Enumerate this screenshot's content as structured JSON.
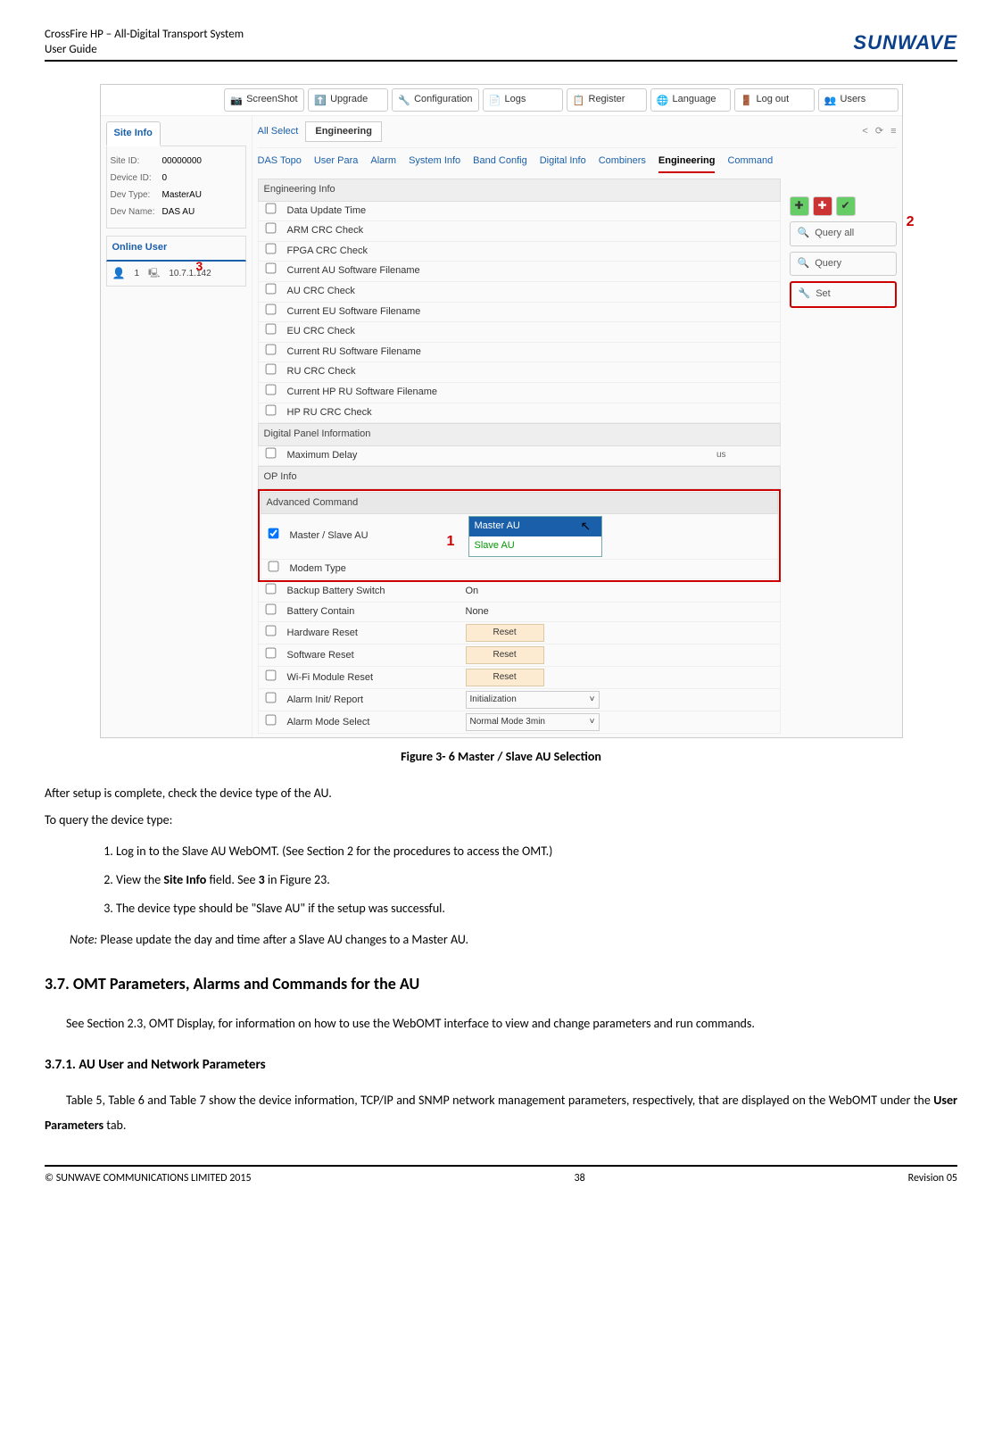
{
  "header": {
    "title": "CrossFire HP – All-Digital Transport System",
    "subtitle": "User Guide",
    "logo": "SUNWAVE"
  },
  "toolbar": {
    "screenshot": "ScreenShot",
    "upgrade": "Upgrade",
    "configuration": "Configuration",
    "logs": "Logs",
    "register": "Register",
    "language": "Language",
    "logout": "Log out",
    "users": "Users"
  },
  "siteinfo": {
    "tab": "Site Info",
    "site_id_lbl": "Site ID:",
    "site_id": "00000000",
    "device_id_lbl": "Device ID:",
    "device_id": "0",
    "dev_type_lbl": "Dev Type:",
    "dev_type": "MasterAU",
    "dev_name_lbl": "Dev Name:",
    "dev_name": "DAS AU",
    "online_user": "Online User",
    "user_num": "1",
    "ip": "10.7.1.142"
  },
  "anno": {
    "a1": "1",
    "a2": "2",
    "a3": "3"
  },
  "toptabs": {
    "all_select": "All Select",
    "engineering": "Engineering"
  },
  "navtabs": [
    "DAS Topo",
    "User Para",
    "Alarm",
    "System Info",
    "Band Config",
    "Digital Info",
    "Combiners",
    "Engineering",
    "Command"
  ],
  "sections": {
    "eng_info": "Engineering Info",
    "digital_panel": "Digital Panel Information",
    "op_info": "OP Info",
    "adv_cmd": "Advanced Command"
  },
  "params": {
    "data_update": "Data Update Time",
    "arm_crc": "ARM CRC Check",
    "fpga_crc": "FPGA CRC Check",
    "cur_au_sw": "Current AU Software Filename",
    "au_crc": "AU CRC Check",
    "cur_eu_sw": "Current EU Software Filename",
    "eu_crc": "EU CRC Check",
    "cur_ru_sw": "Current RU Software Filename",
    "ru_crc": "RU CRC Check",
    "cur_hpru_sw": "Current HP RU Software Filename",
    "hpru_crc": "HP RU CRC Check",
    "max_delay": "Maximum Delay",
    "max_delay_unit": "us",
    "master_slave": "Master / Slave AU",
    "modem_type": "Modem Type",
    "backup_batt": "Backup Battery Switch",
    "backup_batt_val": "On",
    "batt_contain": "Battery Contain",
    "batt_contain_val": "None",
    "hw_reset": "Hardware Reset",
    "sw_reset": "Software Reset",
    "wifi_reset": "Wi-Fi Module Reset",
    "reset_btn": "Reset",
    "alarm_init": "Alarm Init/ Report",
    "alarm_init_val": "Initialization",
    "alarm_mode": "Alarm Mode Select",
    "alarm_mode_val": "Normal Mode 3min"
  },
  "dropdown": {
    "opt_master": "Master AU",
    "opt_slave": "Slave AU"
  },
  "sidebtns": {
    "query_all": "Query all",
    "query": "Query",
    "set": "Set"
  },
  "caption": "Figure 3- 6 Master / Slave AU Selection",
  "text": {
    "p1": "After setup is complete, check the device type of the AU.",
    "p2": "To query the device type:",
    "li1": "Log in to the Slave AU WebOMT. (See Section 2 for the procedures to access the OMT.)",
    "li2a": "View the ",
    "li2b": "Site Info",
    "li2c": " field. See ",
    "li2d": "3",
    "li2e": " in Figure 23.",
    "li3": "The device type should be \"Slave AU\" if the setup was successful.",
    "note_lbl": "Note:",
    "note": " Please update the day and time after a Slave AU changes to a Master AU."
  },
  "h37": "3.7.    OMT Parameters, Alarms and Commands for the AU",
  "p37": "See Section 2.3, OMT Display, for information on how to use the WebOMT interface to view and change parameters and run commands.",
  "h371": "3.7.1.    AU User and Network Parameters",
  "p371a": "Table 5, Table 6 and Table 7 show the device information, TCP/IP and SNMP network management parameters, respectively, that are displayed on the WebOMT under the ",
  "p371b": "User Parameters",
  "p371c": " tab.",
  "footer": {
    "left": "© SUNWAVE COMMUNICATIONS LIMITED 2015",
    "center": "38",
    "right": "Revision 05"
  }
}
